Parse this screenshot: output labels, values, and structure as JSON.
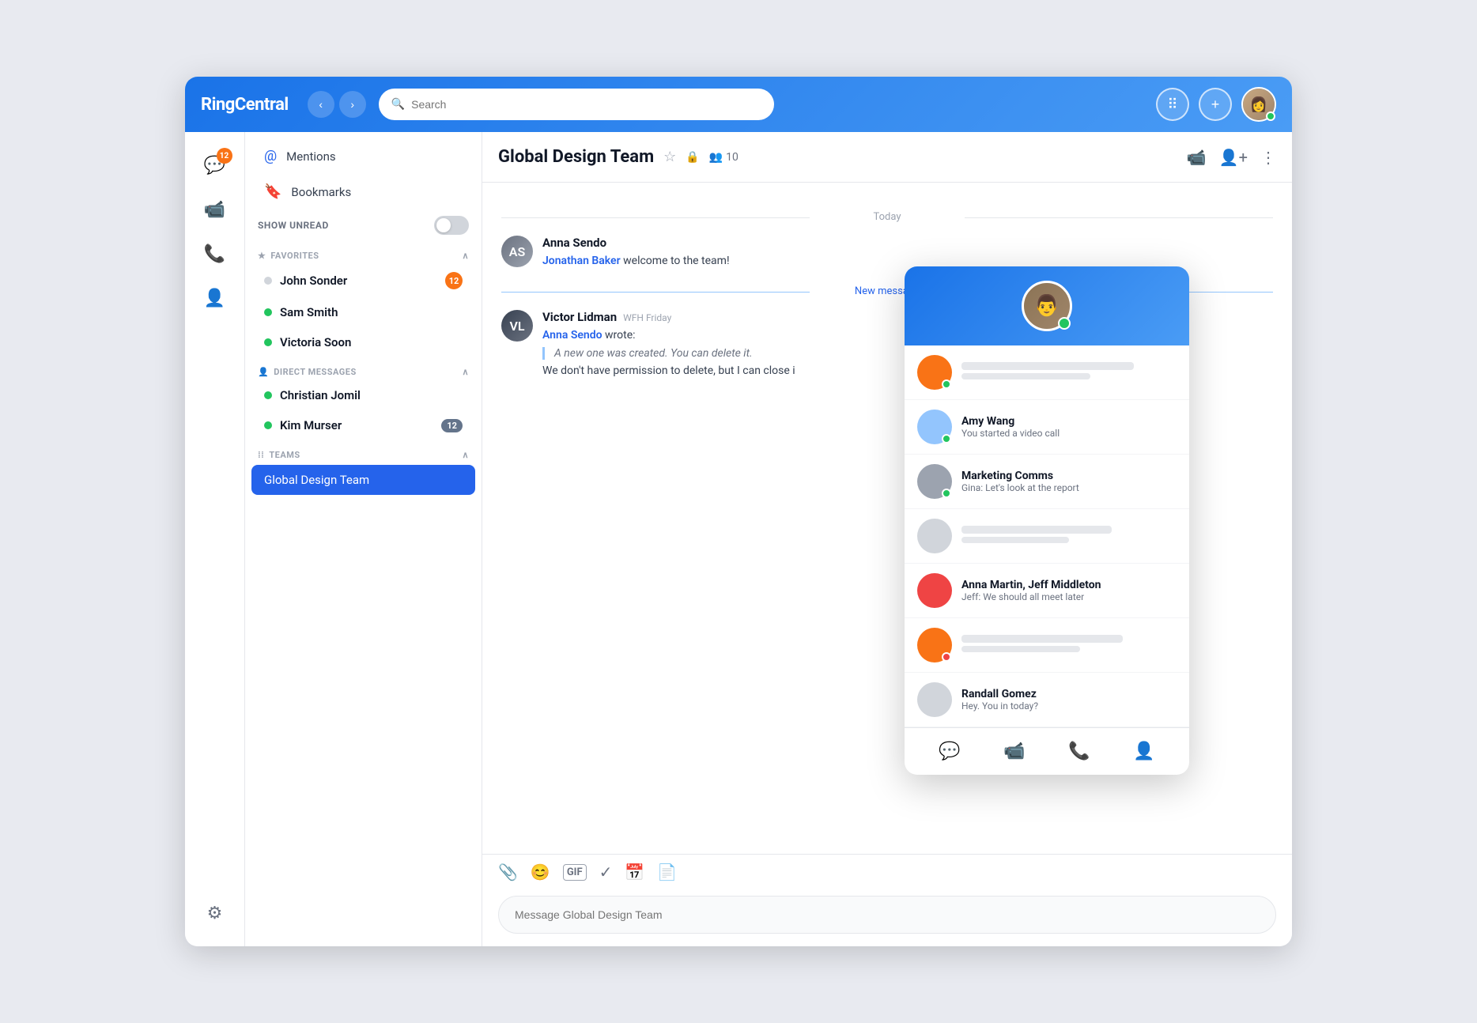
{
  "app": {
    "brand": "RingCentral",
    "search_placeholder": "Search"
  },
  "nav": {
    "back_label": "‹",
    "forward_label": "›",
    "grid_icon": "⠿",
    "plus_icon": "+"
  },
  "icon_sidebar": {
    "chat_badge": "12",
    "items": [
      {
        "id": "chat",
        "icon": "💬",
        "active": true
      },
      {
        "id": "video",
        "icon": "📹",
        "active": false
      },
      {
        "id": "phone",
        "icon": "📞",
        "active": false
      },
      {
        "id": "contacts",
        "icon": "👤",
        "active": false
      }
    ],
    "settings_icon": "⚙"
  },
  "sidebar": {
    "mentions_label": "Mentions",
    "bookmarks_label": "Bookmarks",
    "show_unread_label": "SHOW UNREAD",
    "favorites_label": "FAVORITES",
    "favorites_icon": "★",
    "direct_messages_label": "DIRECT MESSAGES",
    "teams_label": "TEAMS",
    "contacts": [
      {
        "name": "John Sonder",
        "dot": "gray",
        "badge": "12"
      },
      {
        "name": "Sam Smith",
        "dot": "green",
        "badge": ""
      },
      {
        "name": "Victoria Soon",
        "dot": "green",
        "badge": ""
      }
    ],
    "dms": [
      {
        "name": "Christian Jomil",
        "dot": "green",
        "badge": ""
      },
      {
        "name": "Kim Murser",
        "dot": "green",
        "badge": "12"
      }
    ],
    "teams": [
      {
        "name": "Global Design Team",
        "active": true
      }
    ]
  },
  "chat": {
    "title": "Global Design Team",
    "members_count": "10",
    "day_divider": "Today",
    "new_message_divider": "New message",
    "messages": [
      {
        "sender": "Anna Sendo",
        "avatar_initials": "AS",
        "avatar_type": "anna",
        "text_prefix": "",
        "link_name": "Jonathan Baker",
        "text_suffix": " welcome to the team!"
      },
      {
        "sender": "Victor Lidman",
        "time": "WFH Friday",
        "avatar_initials": "VL",
        "avatar_type": "victor",
        "quote_author": "Anna Sendo",
        "quote_text": "A new one was created. You can delete it.",
        "text": "We don't have permission to delete, but I can close i"
      }
    ],
    "input_placeholder": "Message Global Design Team"
  },
  "panel": {
    "items": [
      {
        "id": "placeholder1",
        "avatar_color": "#f97316",
        "dot": "green",
        "name": "",
        "preview": ""
      },
      {
        "id": "amy_wang",
        "avatar_color": "#93c5fd",
        "dot": "green",
        "name": "Amy Wang",
        "preview": "You started a video call"
      },
      {
        "id": "marketing_comms",
        "avatar_color": "#9ca3af",
        "dot": "green",
        "name": "Marketing Comms",
        "preview": "Gina: Let's look at the report"
      },
      {
        "id": "placeholder2",
        "avatar_color": "#9ca3af",
        "dot": "none",
        "name": "",
        "preview": ""
      },
      {
        "id": "anna_martin",
        "avatar_color": "#ef4444",
        "dot": "none",
        "name": "Anna Martin, Jeff Middleton",
        "preview": "Jeff: We should all meet later"
      },
      {
        "id": "placeholder3",
        "avatar_color": "#f97316",
        "dot": "red",
        "name": "",
        "preview": ""
      },
      {
        "id": "randall_gomez",
        "avatar_color": "#9ca3af",
        "dot": "none",
        "name": "Randall Gomez",
        "preview": "Hey. You in today?"
      }
    ],
    "footer_icons": [
      "💬",
      "📹",
      "📞",
      "👤"
    ]
  }
}
